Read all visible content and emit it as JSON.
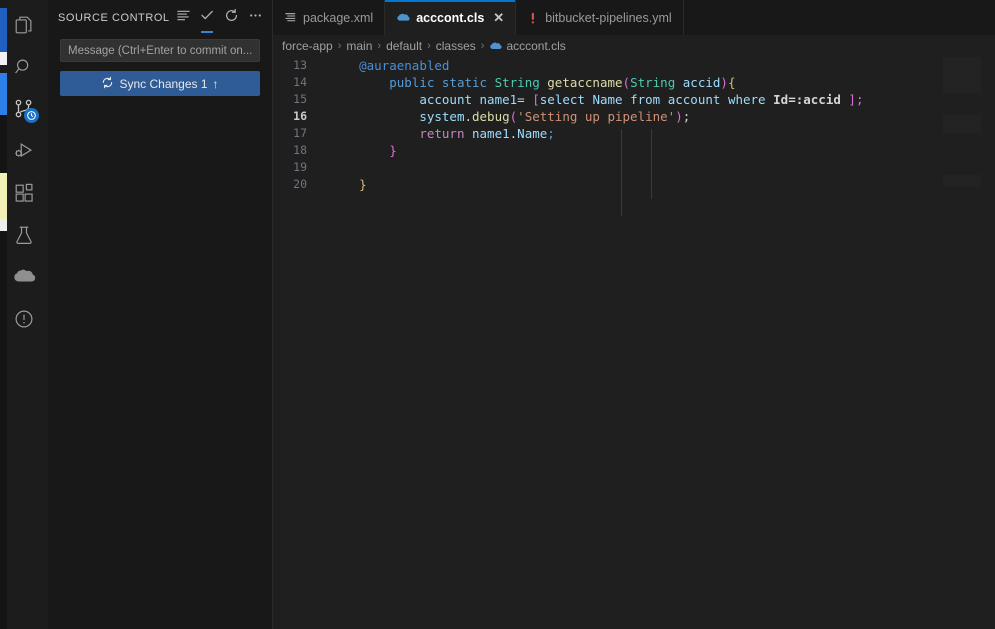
{
  "window": {
    "title": "acccont.cls - Visual Studio Code",
    "theme": "Dark Modern"
  },
  "activity_bar": {
    "items": [
      {
        "id": "explorer",
        "icon": "files-icon",
        "label": "Explorer",
        "active": false,
        "badge": null
      },
      {
        "id": "search",
        "icon": "search-icon",
        "label": "Search",
        "active": false,
        "badge": null
      },
      {
        "id": "source-control",
        "icon": "source-control-icon",
        "label": "Source Control",
        "active": true,
        "badge": "sync-clock-badge"
      },
      {
        "id": "run-debug",
        "icon": "run-and-debug-icon",
        "label": "Run and Debug",
        "active": false,
        "badge": null
      },
      {
        "id": "extensions",
        "icon": "extensions-icon",
        "label": "Extensions",
        "active": false,
        "badge": null
      },
      {
        "id": "testing",
        "icon": "beaker-icon",
        "label": "Testing",
        "active": false,
        "badge": null
      },
      {
        "id": "salesforce",
        "icon": "cloud-icon",
        "label": "Salesforce",
        "active": false,
        "badge": null
      },
      {
        "id": "org-browser",
        "icon": "info-circle-icon",
        "label": "Info",
        "active": false,
        "badge": null
      }
    ]
  },
  "sidebar": {
    "title": "SOURCE CONTROL",
    "actions": [
      {
        "id": "view-as-list",
        "icon": "list-view-icon",
        "label": "View as Tree/List",
        "active": false
      },
      {
        "id": "commit",
        "icon": "check-icon",
        "label": "Commit",
        "active": true
      },
      {
        "id": "refresh",
        "icon": "refresh-icon",
        "label": "Refresh",
        "active": false
      },
      {
        "id": "more-actions",
        "icon": "ellipsis-icon",
        "label": "Views and More Actions...",
        "active": false
      }
    ],
    "commit_input": {
      "value": "",
      "placeholder": "Message (Ctrl+Enter to commit on..."
    },
    "sync_button": {
      "icon": "sync-icon",
      "label": "Sync Changes 1",
      "arrow": "↑"
    }
  },
  "tabs": [
    {
      "id": "package-xml",
      "label": "package.xml",
      "icon": "xml-icon",
      "active": false,
      "dirty": false,
      "closable": false
    },
    {
      "id": "acccont-cls",
      "label": "acccont.cls",
      "icon": "apex-icon",
      "active": true,
      "dirty": false,
      "closable": true,
      "close_glyph": "✕"
    },
    {
      "id": "bitbucket-pipelines",
      "label": "bitbucket-pipelines.yml",
      "icon": "yaml-bang-icon",
      "active": false,
      "dirty": false,
      "closable": false
    }
  ],
  "breadcrumbs": {
    "separator": "›",
    "items": [
      {
        "label": "force-app",
        "icon": null
      },
      {
        "label": "main",
        "icon": null
      },
      {
        "label": "default",
        "icon": null
      },
      {
        "label": "classes",
        "icon": null
      },
      {
        "label": "acccont.cls",
        "icon": "apex-icon"
      }
    ]
  },
  "editor": {
    "language": "apex",
    "current_line": 16,
    "lines": [
      {
        "number": "13",
        "tokens": [
          {
            "text": "    ",
            "cls": "t-plain"
          },
          {
            "text": "@auraenabled",
            "cls": "t-ann"
          }
        ]
      },
      {
        "number": "14",
        "tokens": [
          {
            "text": "        ",
            "cls": "t-plain"
          },
          {
            "text": "public",
            "cls": "t-kw"
          },
          {
            "text": " ",
            "cls": "t-plain"
          },
          {
            "text": "static",
            "cls": "t-kw"
          },
          {
            "text": " ",
            "cls": "t-plain"
          },
          {
            "text": "String",
            "cls": "t-type"
          },
          {
            "text": " ",
            "cls": "t-plain"
          },
          {
            "text": "getaccname",
            "cls": "t-fn"
          },
          {
            "text": "(",
            "cls": "t-brk-p"
          },
          {
            "text": "String",
            "cls": "t-type"
          },
          {
            "text": " ",
            "cls": "t-plain"
          },
          {
            "text": "accid",
            "cls": "t-var"
          },
          {
            "text": ")",
            "cls": "t-brk-p"
          },
          {
            "text": "{",
            "cls": "t-brk-y"
          }
        ]
      },
      {
        "number": "15",
        "tokens": [
          {
            "text": "            ",
            "cls": "t-plain"
          },
          {
            "text": "account",
            "cls": "t-soql"
          },
          {
            "text": " ",
            "cls": "t-plain"
          },
          {
            "text": "name1",
            "cls": "t-var"
          },
          {
            "text": "=",
            "cls": "t-plain"
          },
          {
            "text": " ",
            "cls": "t-plain"
          },
          {
            "text": "[",
            "cls": "t-brk-p"
          },
          {
            "text": "select",
            "cls": "t-soql"
          },
          {
            "text": " ",
            "cls": "t-plain"
          },
          {
            "text": "Name",
            "cls": "t-soql"
          },
          {
            "text": " ",
            "cls": "t-plain"
          },
          {
            "text": "from",
            "cls": "t-soql"
          },
          {
            "text": " ",
            "cls": "t-plain"
          },
          {
            "text": "account",
            "cls": "t-soql"
          },
          {
            "text": " ",
            "cls": "t-plain"
          },
          {
            "text": "where",
            "cls": "t-soql"
          },
          {
            "text": " ",
            "cls": "t-plain"
          },
          {
            "text": "Id",
            "cls": "t-soql-b"
          },
          {
            "text": "=",
            "cls": "t-soql-b"
          },
          {
            "text": ":accid",
            "cls": "t-soql-b"
          },
          {
            "text": " ",
            "cls": "t-plain"
          },
          {
            "text": "]",
            "cls": "t-brk-p"
          },
          {
            "text": ";",
            "cls": "t-brk-p"
          }
        ]
      },
      {
        "number": "16",
        "current": true,
        "tokens": [
          {
            "text": "            ",
            "cls": "t-plain"
          },
          {
            "text": "system",
            "cls": "t-var"
          },
          {
            "text": ".",
            "cls": "t-plain"
          },
          {
            "text": "debug",
            "cls": "t-fn"
          },
          {
            "text": "(",
            "cls": "t-brk-p"
          },
          {
            "text": "'Setting up pipeline'",
            "cls": "t-str"
          },
          {
            "text": ")",
            "cls": "t-brk-p"
          },
          {
            "text": ";",
            "cls": "t-plain"
          }
        ]
      },
      {
        "number": "17",
        "tokens": [
          {
            "text": "            ",
            "cls": "t-plain"
          },
          {
            "text": "return",
            "cls": "t-kw2"
          },
          {
            "text": " ",
            "cls": "t-plain"
          },
          {
            "text": "name1",
            "cls": "t-var"
          },
          {
            "text": ".",
            "cls": "t-plain"
          },
          {
            "text": "Name",
            "cls": "t-var"
          },
          {
            "text": ";",
            "cls": "t-semi"
          }
        ]
      },
      {
        "number": "18",
        "tokens": [
          {
            "text": "        ",
            "cls": "t-plain"
          },
          {
            "text": "}",
            "cls": "t-brk-p"
          }
        ]
      },
      {
        "number": "19",
        "tokens": [
          {
            "text": "",
            "cls": "t-plain"
          }
        ]
      },
      {
        "number": "20",
        "tokens": [
          {
            "text": "    ",
            "cls": "t-plain"
          },
          {
            "text": "}",
            "cls": "t-brk-y"
          }
        ]
      }
    ]
  },
  "colors": {
    "accent_blue": "#0078d4",
    "sync_button_bg": "#2f5c96",
    "activity_bar_bg": "#1c1c1c",
    "sidebar_bg": "#181818",
    "editor_bg": "#1f1f1f",
    "badge_blue": "#1a72c8",
    "edge_yellow": "#f2f0b4"
  }
}
